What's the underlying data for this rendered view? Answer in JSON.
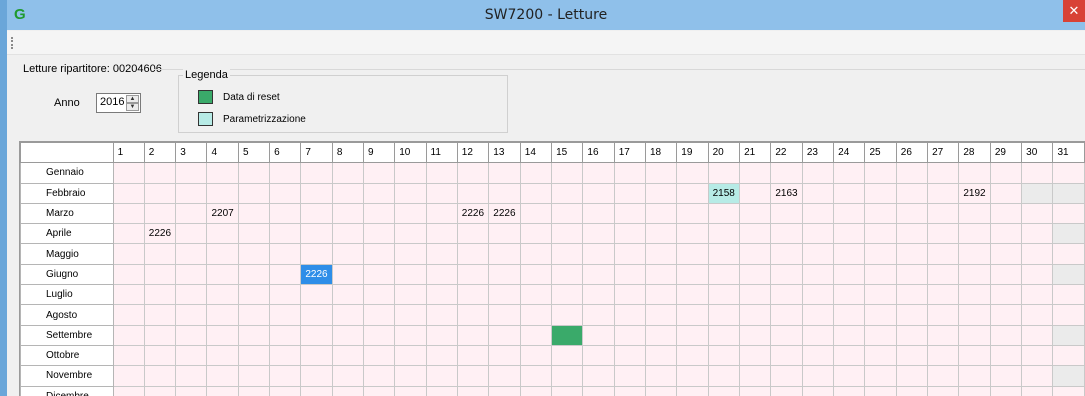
{
  "window": {
    "title": "SW7200 - Letture",
    "app_icon": "app-logo-icon",
    "close_glyph": "✕"
  },
  "reader_label": "Letture ripartitore: 00204606",
  "anno": {
    "label": "Anno",
    "value": "2016"
  },
  "legend": {
    "title": "Legenda",
    "items": [
      {
        "label": "Data di reset",
        "color": "#3aaa6a"
      },
      {
        "label": "Parametrizzazione",
        "color": "#b7ebe6"
      }
    ]
  },
  "grid": {
    "days": [
      "1",
      "2",
      "3",
      "4",
      "5",
      "6",
      "7",
      "8",
      "9",
      "10",
      "11",
      "12",
      "13",
      "14",
      "15",
      "16",
      "17",
      "18",
      "19",
      "20",
      "21",
      "22",
      "23",
      "24",
      "25",
      "26",
      "27",
      "28",
      "29",
      "30",
      "31"
    ],
    "days_in_month": [
      31,
      29,
      31,
      30,
      31,
      30,
      31,
      31,
      30,
      31,
      30,
      31
    ],
    "months": [
      "Gennaio",
      "Febbraio",
      "Marzo",
      "Aprile",
      "Maggio",
      "Giugno",
      "Luglio",
      "Agosto",
      "Settembre",
      "Ottobre",
      "Novembre",
      "Dicembre"
    ],
    "entries": [
      {
        "month": 1,
        "day": 20,
        "text": "2158",
        "kind": "param"
      },
      {
        "month": 1,
        "day": 22,
        "text": "2163",
        "kind": ""
      },
      {
        "month": 1,
        "day": 28,
        "text": "2192",
        "kind": ""
      },
      {
        "month": 2,
        "day": 4,
        "text": "2207",
        "kind": ""
      },
      {
        "month": 2,
        "day": 12,
        "text": "2226",
        "kind": ""
      },
      {
        "month": 2,
        "day": 13,
        "text": "2226",
        "kind": ""
      },
      {
        "month": 3,
        "day": 2,
        "text": "2226",
        "kind": ""
      },
      {
        "month": 5,
        "day": 7,
        "text": "2226",
        "kind": "sel"
      },
      {
        "month": 8,
        "day": 15,
        "text": "",
        "kind": "reset"
      }
    ]
  }
}
